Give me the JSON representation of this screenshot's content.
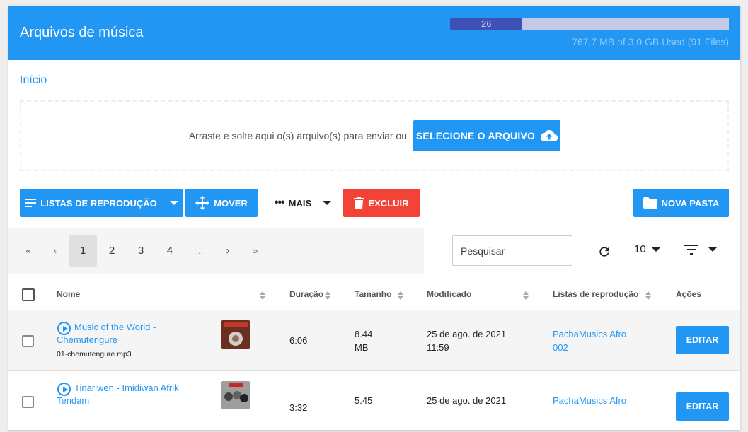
{
  "header": {
    "title": "Arquivos de música",
    "quota_label": "26",
    "quota_fraction": 0.26,
    "quota_text": "767.7 MB of 3.0 GB Used (91 Files)"
  },
  "breadcrumb": "Início",
  "dropzone": {
    "text": "Arraste e solte aqui o(s) arquivo(s) para enviar ou",
    "button_label": "SELECIONE O ARQUIVO"
  },
  "toolbar": {
    "playlists_label": "LISTAS DE REPRODUÇÃO",
    "move_label": "MOVER",
    "more_label": "MAIS",
    "delete_label": "EXCLUIR",
    "new_folder_label": "NOVA PASTA"
  },
  "pagination": {
    "first": "«",
    "prev": "‹",
    "pages": [
      "1",
      "2",
      "3",
      "4"
    ],
    "ellipsis": "...",
    "next": "›",
    "last": "»",
    "current": "1"
  },
  "search": {
    "placeholder": "Pesquisar"
  },
  "per_page": "10",
  "table": {
    "columns": {
      "name": "Nome",
      "duration": "Duração",
      "size": "Tamanho",
      "modified": "Modificado",
      "playlists": "Listas de reprodução",
      "actions": "Ações"
    },
    "rows": [
      {
        "title": "Music of the World - Chemutengure",
        "file": "01-chemutengure.mp3",
        "duration": "6:06",
        "size": "8.44 MB",
        "modified": "25 de ago. de 2021 11:59",
        "playlist": "PachaMusics Afro 002",
        "action": "EDITAR"
      },
      {
        "title": "Tinariwen - Imidiwan Afrik Tendam",
        "file": "",
        "duration": "3:32",
        "size": "5.45",
        "modified": "25 de ago. de 2021",
        "playlist": "PachaMusics Afro",
        "action": "EDITAR"
      }
    ]
  },
  "colors": {
    "primary": "#2196f3",
    "danger": "#f44336",
    "quota_fill": "#3f51b5",
    "quota_bg": "#c5cae9"
  }
}
